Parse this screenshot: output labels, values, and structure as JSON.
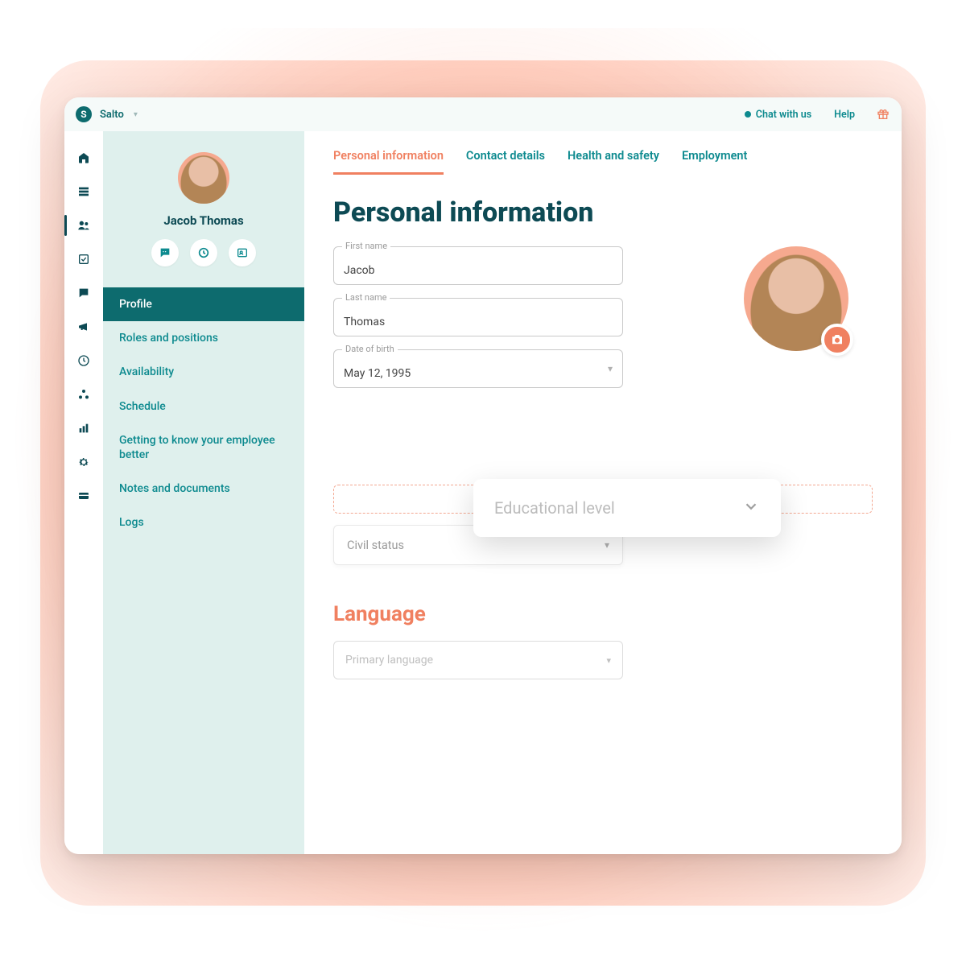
{
  "brand": {
    "letter": "S",
    "name": "Salto"
  },
  "topbar": {
    "chat": "Chat with us",
    "help": "Help"
  },
  "profile": {
    "name": "Jacob Thomas"
  },
  "sidenav": {
    "items": [
      "Profile",
      "Roles and positions",
      "Availability",
      "Schedule",
      "Getting to know your employee better",
      "Notes and documents",
      "Logs"
    ]
  },
  "tabs": {
    "items": [
      "Personal information",
      "Contact details",
      "Health and safety",
      "Employment"
    ]
  },
  "page": {
    "title": "Personal information"
  },
  "fields": {
    "first_name": {
      "label": "First name",
      "value": "Jacob"
    },
    "last_name": {
      "label": "Last name",
      "value": "Thomas"
    },
    "dob": {
      "label": "Date of birth",
      "value": "May 12, 1995"
    }
  },
  "floating": {
    "educational_level": "Educational level"
  },
  "civil_status": {
    "placeholder": "Civil status"
  },
  "language_section": {
    "heading": "Language",
    "primary_placeholder": "Primary language"
  },
  "colors": {
    "accent": "#f08060",
    "teal_dark": "#0d4a54",
    "teal": "#0d8a8f",
    "panel": "#dff0ed"
  }
}
